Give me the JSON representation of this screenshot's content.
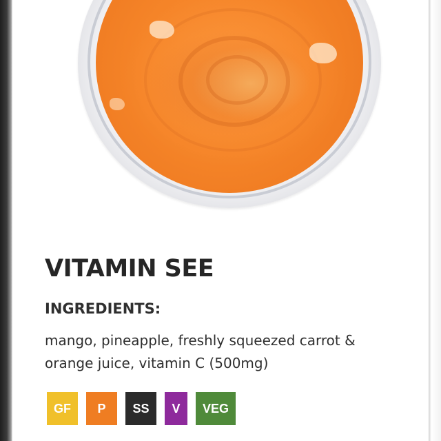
{
  "item": {
    "title": "VITAMIN SEE",
    "ingredients_heading": "INGREDIENTS:",
    "ingredients_line1": "mango, pineapple, freshly squeezed carrot &",
    "ingredients_line2": "orange juice, vitamin C (500mg)"
  },
  "photo": {
    "subject": "orange smoothie in clear cup (top view)",
    "smoothie_color": "#f58428"
  },
  "badges": [
    {
      "label": "GF",
      "color": "#f0c02a",
      "text_color": "#ffffff"
    },
    {
      "label": "P",
      "color": "#ef7d22",
      "text_color": "#ffffff"
    },
    {
      "label": "SS",
      "color": "#2b2b2b",
      "text_color": "#ffffff"
    },
    {
      "label": "V",
      "color": "#8e2a9c",
      "text_color": "#ffffff"
    },
    {
      "label": "VEG",
      "color": "#4f8a3a",
      "text_color": "#ffffff"
    }
  ]
}
